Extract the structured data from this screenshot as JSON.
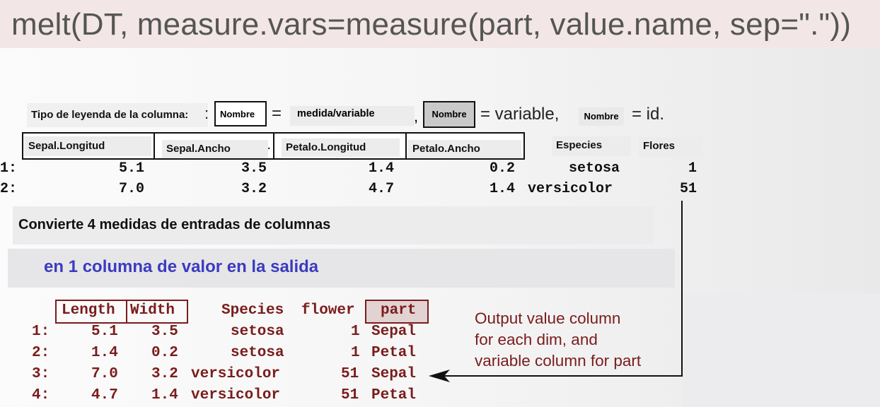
{
  "title": "melt(DT, measure.vars=measure(part, value.name, sep=\".\"))",
  "legend": {
    "label": "Tipo de leyenda de la columna:",
    "colon": ":",
    "box1": "Nombre",
    "eq1": "=",
    "medida": "medida/variable",
    "comma": ",",
    "box2": "Nombre",
    "eq2": "= variable,",
    "box3": "Nombre",
    "eq3": "= id."
  },
  "input_table": {
    "headers": [
      "Sepal.Longitud",
      "Sepal.Ancho",
      "Petalo.Longitud",
      "Petalo.Ancho",
      "Especies",
      "Flores"
    ],
    "header_dot": ".",
    "rows": [
      {
        "idx": "1:",
        "v1": "5.1",
        "v2": "3.5",
        "v3": "1.4",
        "v4": "0.2",
        "species": "setosa",
        "flower": "1"
      },
      {
        "idx": "2:",
        "v1": "7.0",
        "v2": "3.2",
        "v3": "4.7",
        "v4": "1.4",
        "species": "versicolor",
        "flower": "51"
      }
    ]
  },
  "band1": "Convierte 4 medidas de entradas de columnas",
  "band2": "en 1 columna de valor en la salida",
  "output_table": {
    "headers": [
      "Length",
      "Width",
      "Species",
      "flower",
      "part"
    ],
    "rows": [
      {
        "idx": "1:",
        "length": "5.1",
        "width": "3.5",
        "species": "setosa",
        "flower": "1",
        "part": "Sepal"
      },
      {
        "idx": "2:",
        "length": "1.4",
        "width": "0.2",
        "species": "setosa",
        "flower": "1",
        "part": "Petal"
      },
      {
        "idx": "3:",
        "length": "7.0",
        "width": "3.2",
        "species": "versicolor",
        "flower": "51",
        "part": "Sepal"
      },
      {
        "idx": "4:",
        "length": "4.7",
        "width": "1.4",
        "species": "versicolor",
        "flower": "51",
        "part": "Petal"
      }
    ]
  },
  "annotation": {
    "line1": "Output value column",
    "line2": "for each dim, and",
    "line3": "variable column for part"
  },
  "colors": {
    "output_text": "#7a1c1c",
    "band2_text": "#3b3bc0",
    "title_bg": "#f2e6e6"
  }
}
